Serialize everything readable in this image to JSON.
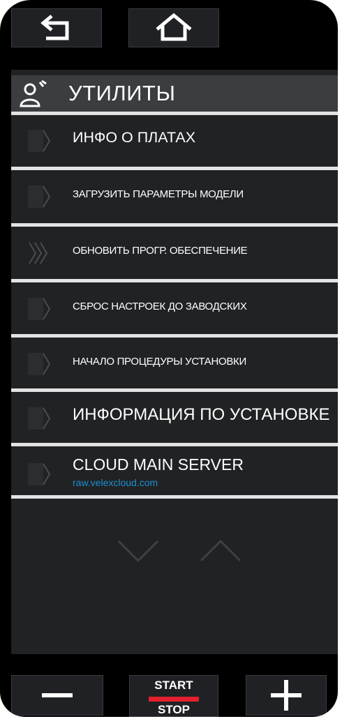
{
  "topbar": {
    "back_icon": "back-arrow-icon",
    "home_icon": "home-icon"
  },
  "header": {
    "icon": "utilities-person-wrench-icon",
    "title": "УТИЛИТЫ"
  },
  "menu": [
    {
      "label": "ИНФО О ПЛАТАХ",
      "icon": "chevron-right-icon"
    },
    {
      "label": "ЗАГРУЗИТЬ ПАРАМЕТРЫ МОДЕЛИ",
      "icon": "chevron-right-icon"
    },
    {
      "label": "ОБНОВИТЬ ПРОГР. ОБЕСПЕЧЕНИЕ",
      "icon": "triple-chevron-right-icon"
    },
    {
      "label": "СБРОС НАСТРОЕК ДО ЗАВОДСКИХ",
      "icon": "chevron-right-icon"
    },
    {
      "label": "НАЧАЛО ПРОЦЕДУРЫ УСТАНОВКИ",
      "icon": "chevron-right-icon"
    },
    {
      "label": "ИНФОРМАЦИЯ ПО УСТАНОВКЕ",
      "icon": "chevron-right-icon"
    }
  ],
  "cloud": {
    "title": "CLOUD MAIN SERVER",
    "url": "raw.velexcloud.com",
    "url_color": "#1e90d6"
  },
  "pager": {
    "down_icon": "chevron-down-icon",
    "up_icon": "chevron-up-icon"
  },
  "bottombar": {
    "minus_icon": "minus-icon",
    "plus_icon": "plus-icon",
    "start_label": "START",
    "stop_label": "STOP",
    "accent_color": "#e5202e"
  }
}
